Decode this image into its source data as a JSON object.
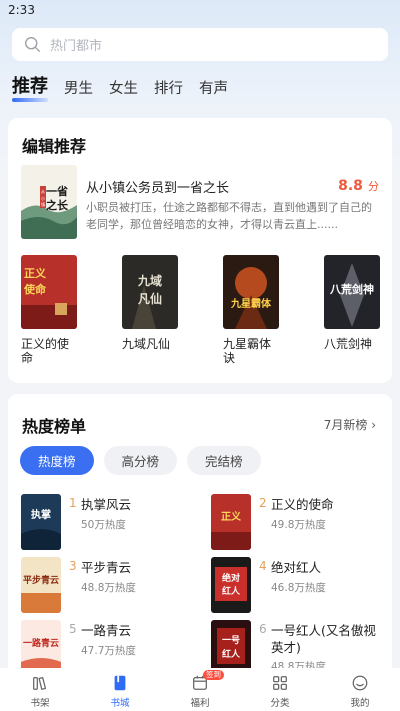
{
  "status_bar": {
    "time": "2:33"
  },
  "search": {
    "placeholder": "热门都市"
  },
  "tabs": [
    {
      "label": "推荐",
      "active": true
    },
    {
      "label": "男生"
    },
    {
      "label": "女生"
    },
    {
      "label": "排行"
    },
    {
      "label": "有声"
    }
  ],
  "editor": {
    "title": "编辑推荐",
    "featured": {
      "title": "从小镇公务员到一省之长",
      "score": "8.8",
      "score_unit": "分",
      "desc": "小职员被打压，仕途之路都郁不得志，直到他遇到了自己的老同学，那位曾经暗恋的女神，才得以青云直上......",
      "cover_text": "一省之长"
    },
    "books": [
      {
        "title": "正义的使命",
        "cover_text": "正义的使命"
      },
      {
        "title": "九域凡仙",
        "cover_text": "九域凡仙"
      },
      {
        "title": "九星霸体诀",
        "cover_text": "九星霸体"
      },
      {
        "title": "八荒剑神",
        "cover_text": "八荒剑神"
      }
    ]
  },
  "hot": {
    "title": "热度榜单",
    "more": "7月新榜",
    "pills": [
      {
        "label": "热度榜",
        "active": true
      },
      {
        "label": "高分榜"
      },
      {
        "label": "完结榜"
      }
    ],
    "ranks": [
      {
        "num": "1",
        "title": "执掌风云",
        "heat": "50万热度",
        "cover_text": "执掌"
      },
      {
        "num": "2",
        "title": "正义的使命",
        "heat": "49.8万热度",
        "cover_text": "正义"
      },
      {
        "num": "3",
        "title": "平步青云",
        "heat": "48.8万热度",
        "cover_text": "平步青云"
      },
      {
        "num": "4",
        "title": "绝对红人",
        "heat": "46.8万热度",
        "cover_text": "绝对红人"
      },
      {
        "num": "5",
        "title": "一路青云",
        "heat": "47.7万热度",
        "cover_text": "一路青云"
      },
      {
        "num": "6",
        "title": "一号红人(又名傲视英才)",
        "heat": "48.8万热度",
        "cover_text": "一号红人"
      }
    ]
  },
  "nav": {
    "items": [
      {
        "label": "书架",
        "icon": "bookshelf-icon"
      },
      {
        "label": "书城",
        "icon": "bookstore-icon",
        "active": true
      },
      {
        "label": "福利",
        "icon": "welfare-icon",
        "badge": "签到"
      },
      {
        "label": "分类",
        "icon": "category-icon"
      },
      {
        "label": "我的",
        "icon": "profile-icon"
      }
    ]
  },
  "colors": {
    "accent": "#2f6cf5",
    "score": "#ef5a3c",
    "rank_top": "#e3a15c"
  }
}
